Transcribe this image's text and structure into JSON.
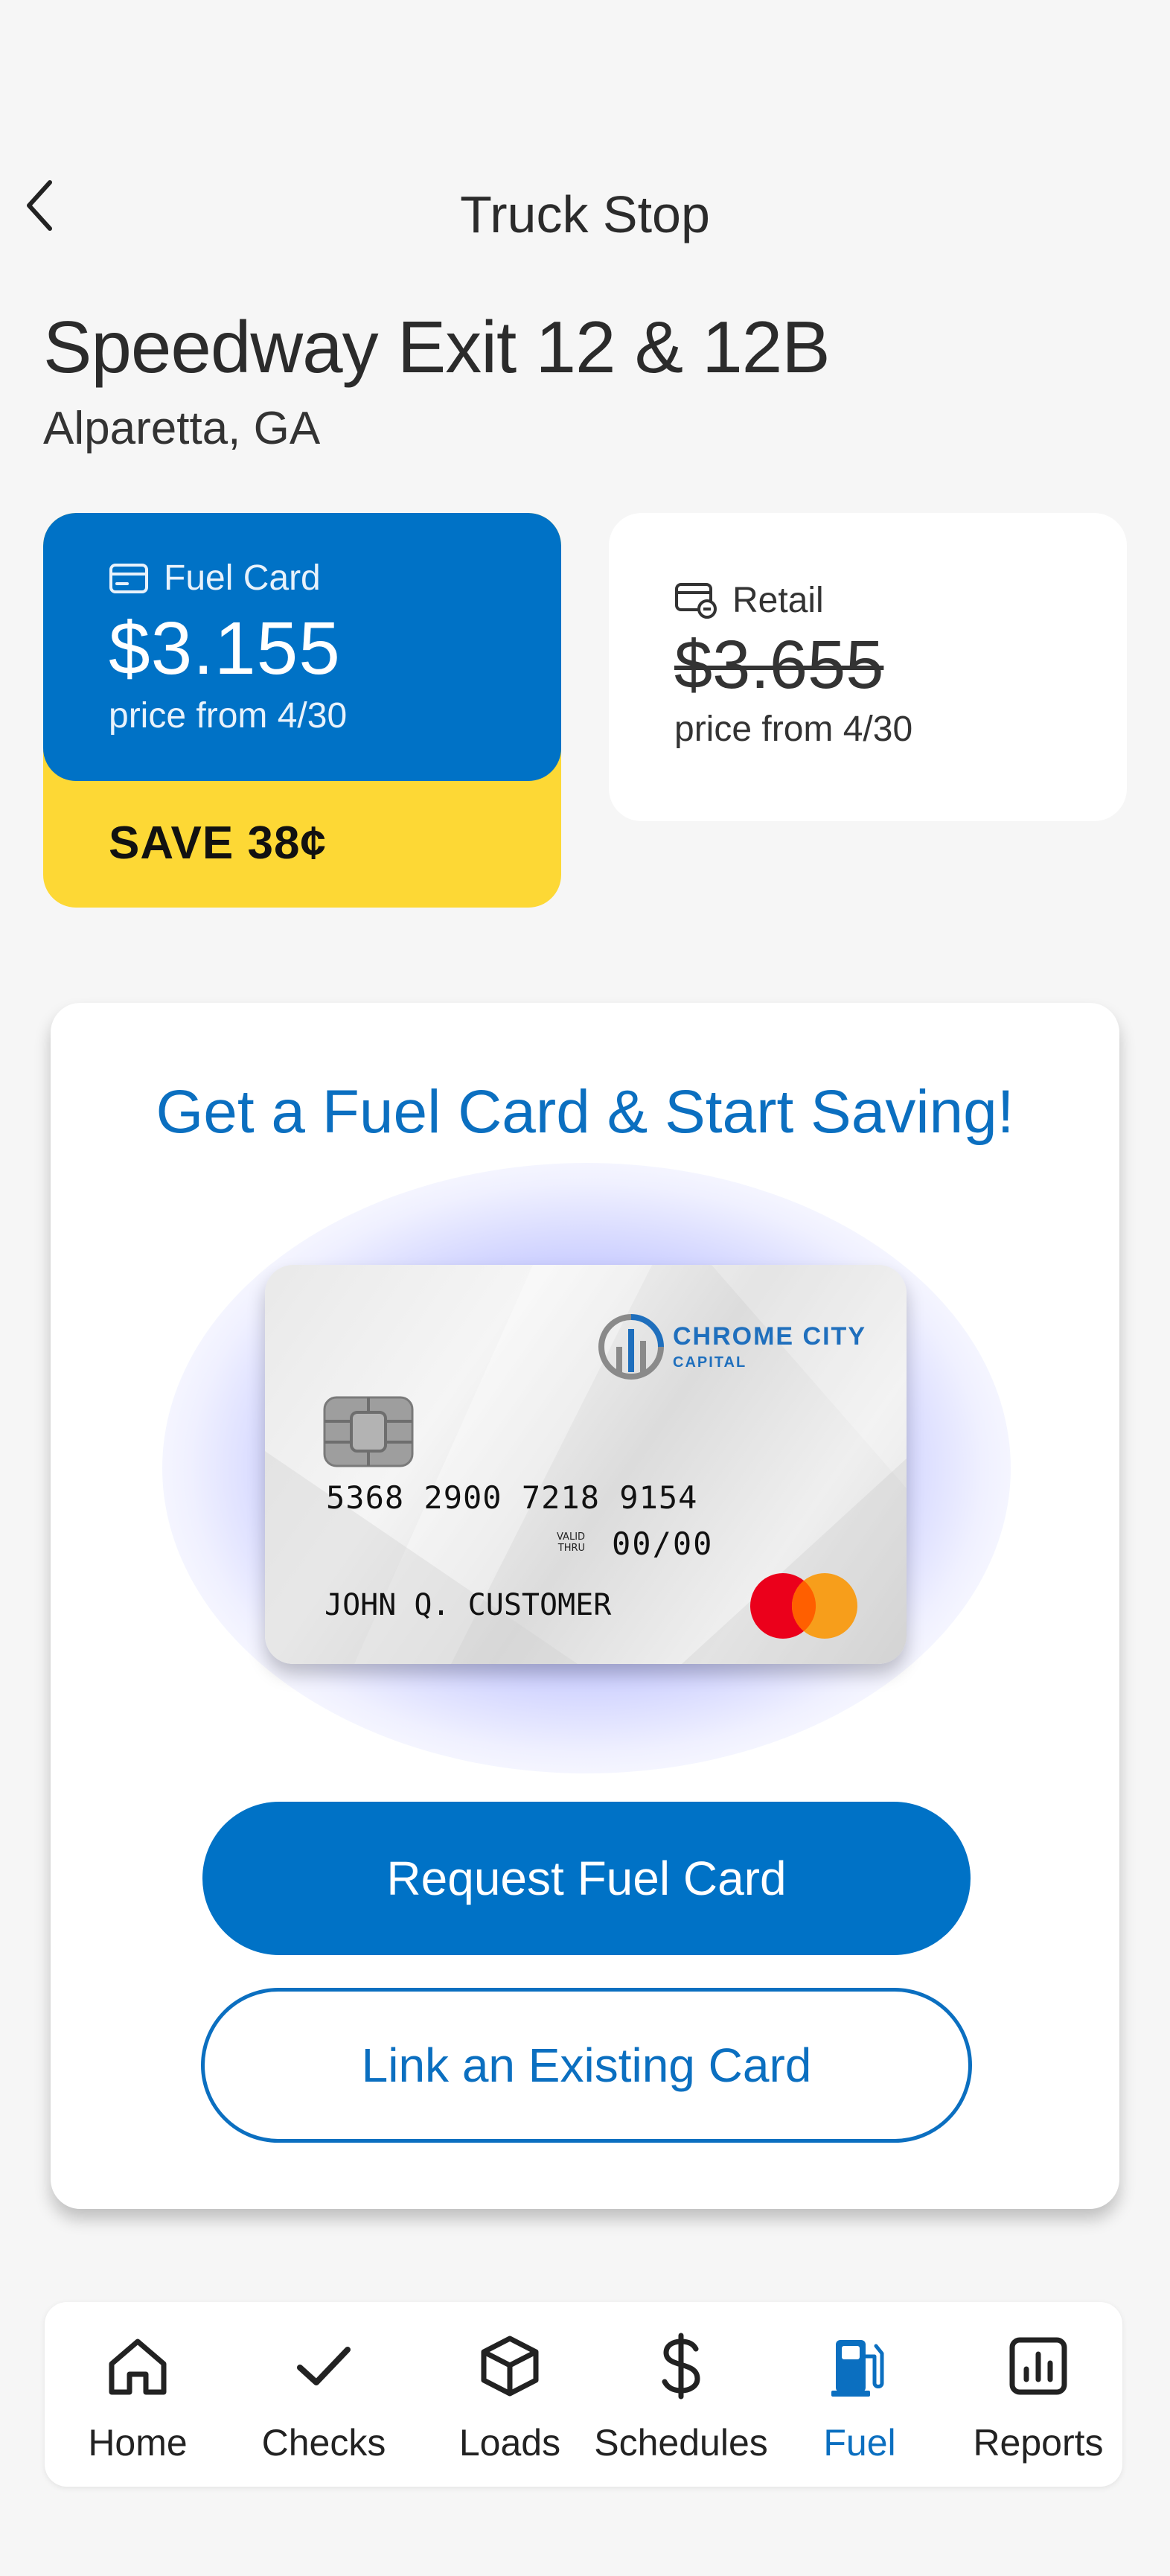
{
  "header": {
    "title": "Truck Stop"
  },
  "station": {
    "name": "Speedway Exit 12 & 12B",
    "location": "Alparetta, GA"
  },
  "fuel_card_price": {
    "label": "Fuel Card",
    "price": "$3.155",
    "date": "price from 4/30",
    "savings": "SAVE 38¢",
    "accent_color": "#0072c6",
    "savings_color": "#fdd835"
  },
  "retail_price": {
    "label": "Retail",
    "price": "$3.655",
    "date": "price from 4/30"
  },
  "promo": {
    "title": "Get a Fuel Card & Start Saving!",
    "card": {
      "brand_name": "CHROME CITY",
      "brand_sub": "CAPITAL",
      "number": "5368 2900 7218 9154",
      "valid_label_1": "VALID",
      "valid_label_2": "THRU",
      "expiry": "00/00",
      "holder": "JOHN Q. CUSTOMER",
      "network_icon": "mastercard-logo"
    },
    "primary_button": "Request Fuel Card",
    "secondary_button": "Link an Existing Card"
  },
  "bottom_nav": {
    "active": "Fuel",
    "items": [
      {
        "label": "Home",
        "icon": "home-icon"
      },
      {
        "label": "Checks",
        "icon": "check-icon"
      },
      {
        "label": "Loads",
        "icon": "box-icon"
      },
      {
        "label": "Schedules",
        "icon": "dollar-icon"
      },
      {
        "label": "Fuel",
        "icon": "fuel-pump-icon"
      },
      {
        "label": "Reports",
        "icon": "bar-chart-icon"
      }
    ]
  }
}
